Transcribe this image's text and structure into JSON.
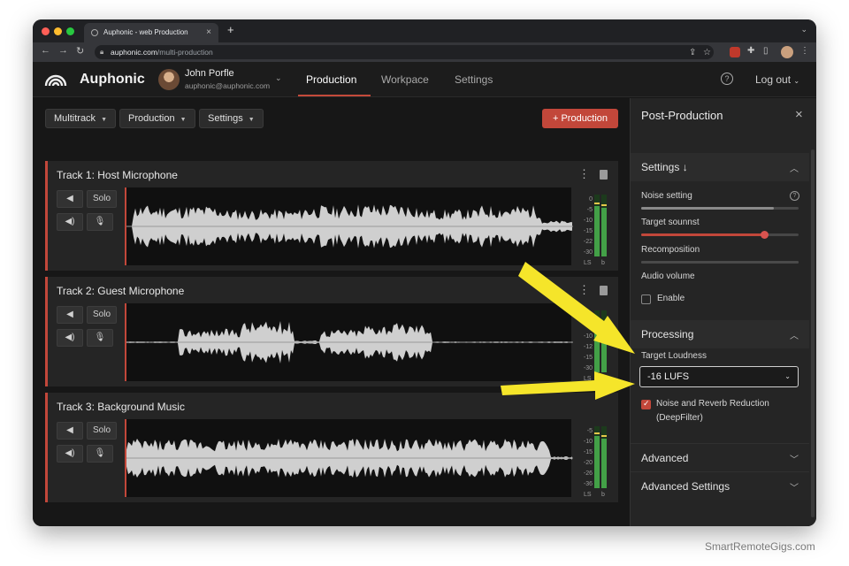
{
  "browser": {
    "tab_title": "Auphonic - web Production",
    "url_host": "auphonic.com",
    "url_path": "/multi-production"
  },
  "app": {
    "brand": "Auphonic",
    "user": {
      "name": "John Porfle",
      "email": "auphonic@auphonic.com"
    },
    "nav": [
      "Production",
      "Workpace",
      "Settings"
    ],
    "logout": "Log out"
  },
  "toolbar": {
    "multitrack": "Multitrack",
    "production": "Production",
    "settings": "Settings",
    "add_production": "Production"
  },
  "tracks": [
    {
      "title": "Track 1: Host Microphone",
      "solo": "Solo",
      "meter_ticks": [
        "0",
        "-5",
        "-10",
        "-15",
        "-22",
        "-30"
      ],
      "meter_left": "LS",
      "meter_right": "b",
      "meter_levels": [
        0.82,
        0.78
      ]
    },
    {
      "title": "Track 2: Guest Microphone",
      "solo": "Solo",
      "meter_ticks": [
        "0",
        "-5",
        "-10",
        "-12",
        "-15",
        "-30"
      ],
      "meter_left": "LS",
      "meter_right": "b",
      "meter_levels": [
        0.78,
        0.74
      ]
    },
    {
      "title": "Track 3: Background Music",
      "solo": "Solo",
      "meter_ticks": [
        "-5",
        "-10",
        "-15",
        "-20",
        "-26",
        "-36"
      ],
      "meter_left": "LS",
      "meter_right": "b",
      "meter_levels": [
        0.85,
        0.8
      ]
    }
  ],
  "sidebar": {
    "title": "Post-Production",
    "settings_head": "Settings ↓",
    "noise_setting": "Noise setting",
    "noise_level": 0.84,
    "target_sound": "Target sounnst",
    "target_sound_level": 0.78,
    "recomposition": "Recomposition",
    "recomposition_level": 1.0,
    "audio_volume": "Audio volume",
    "enable": "Enable",
    "processing_head": "Processing",
    "target_loudness": "Target Loudness",
    "loudness_value": "-16 LUFS",
    "noise_reduction": "Noise and Reverb Reduction",
    "noise_reduction_sub": "(DeepFilter)",
    "advanced": "Advanced",
    "advanced_settings": "Advanced Settings"
  },
  "watermark": "SmartRemoteGigs.com",
  "colors": {
    "accent": "#c2473a",
    "annotation_arrow": "#f5e52a",
    "meter_green": "#43a047"
  },
  "icons": [
    "back-icon",
    "forward-icon",
    "reload-icon",
    "lock-icon",
    "share-icon",
    "star-icon",
    "puzzle-icon",
    "sidepanel-icon",
    "kebab-icon",
    "help-icon",
    "chevron-down-icon",
    "speaker-icon",
    "mic-icon",
    "trash-icon",
    "close-icon"
  ]
}
